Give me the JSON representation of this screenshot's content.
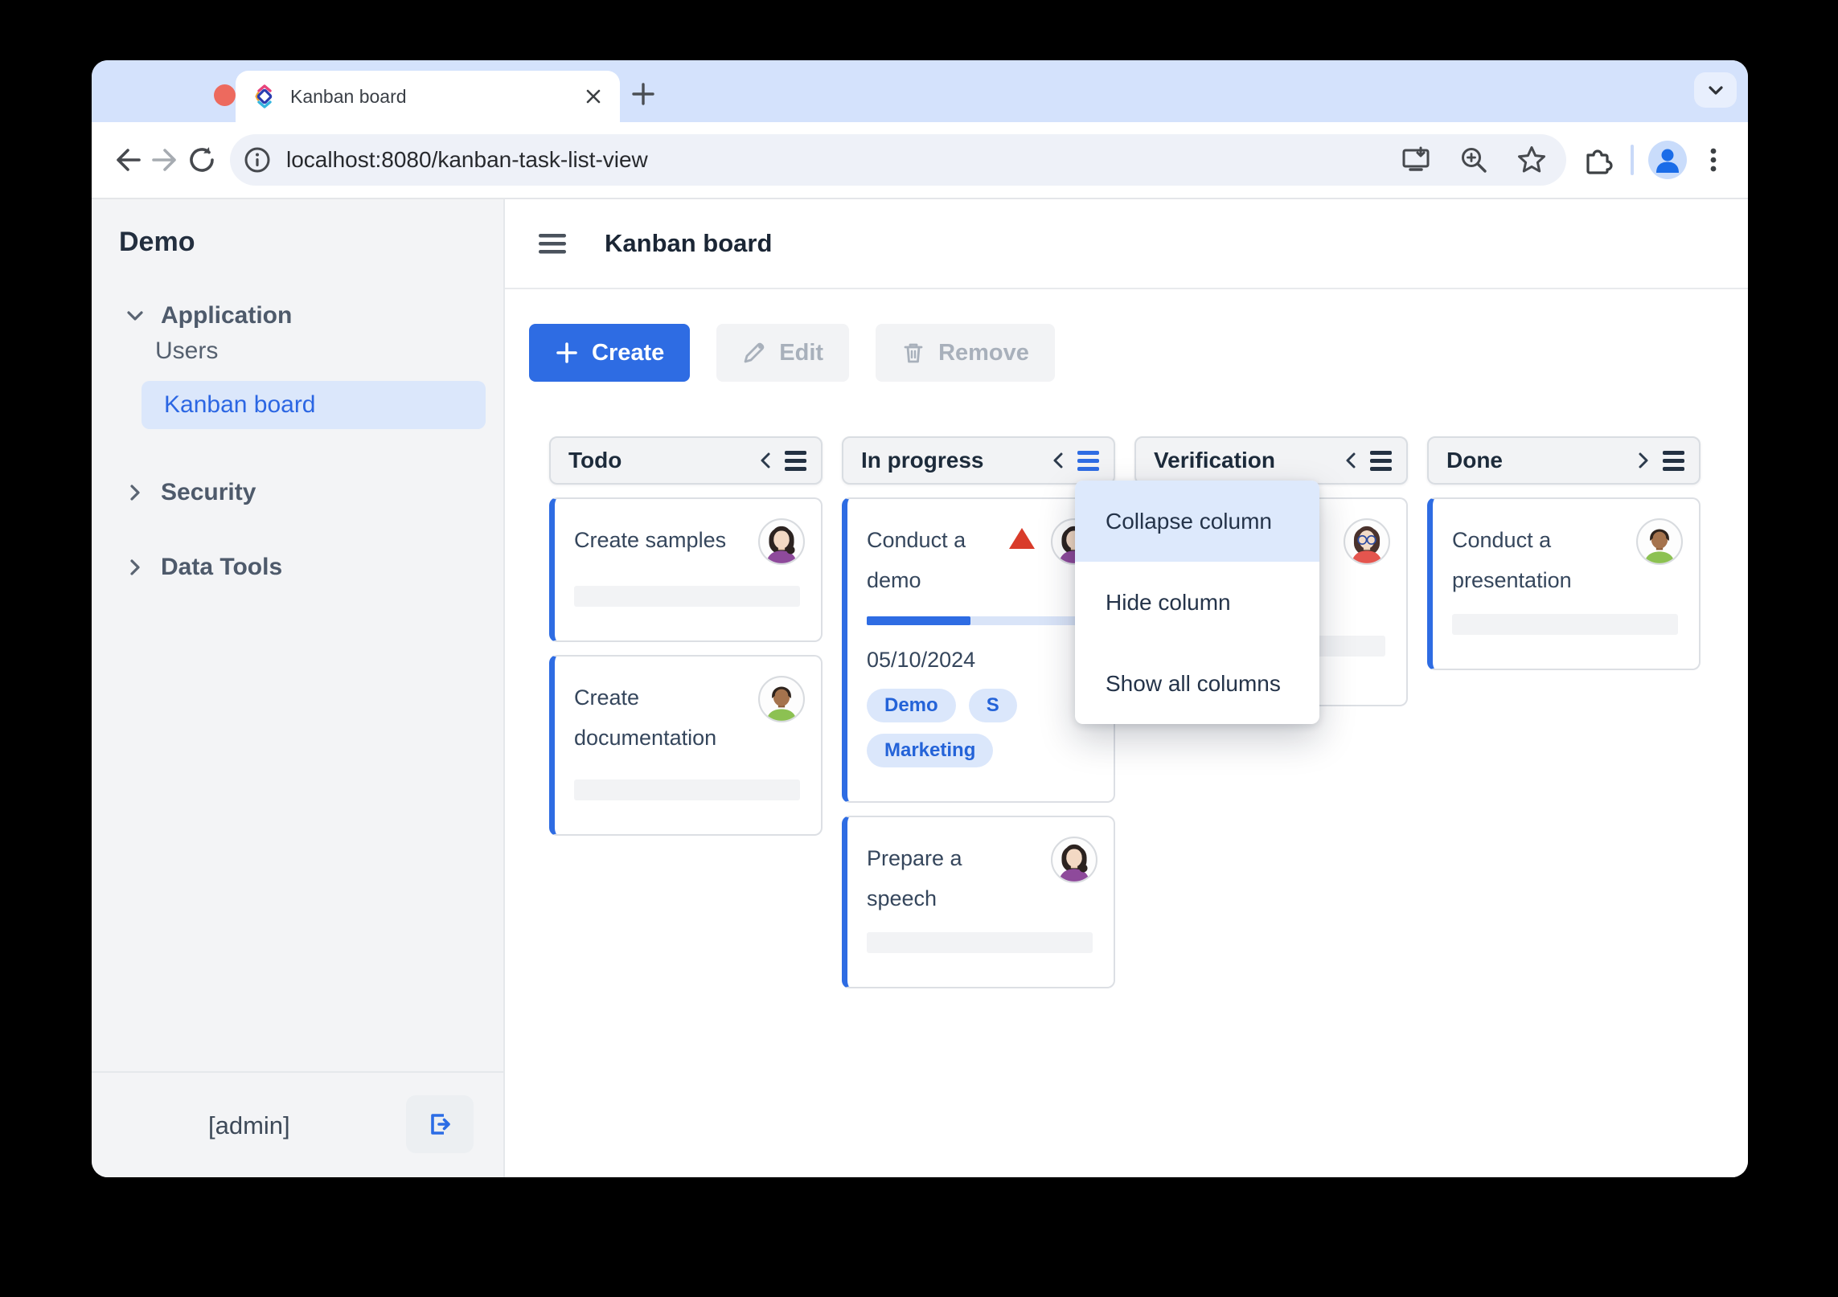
{
  "browser": {
    "tab_title": "Kanban board",
    "url": "localhost:8080/kanban-task-list-view"
  },
  "sidebar": {
    "app_title": "Demo",
    "sections": [
      {
        "label": "Application",
        "expanded": true
      },
      {
        "label": "Security",
        "expanded": false
      },
      {
        "label": "Data Tools",
        "expanded": false
      }
    ],
    "items": [
      {
        "label": "Users",
        "selected": false
      },
      {
        "label": "Kanban board",
        "selected": true
      }
    ],
    "footer": {
      "user": "[admin]"
    }
  },
  "main": {
    "title": "Kanban board",
    "toolbar": {
      "create": "Create",
      "edit": "Edit",
      "remove": "Remove"
    }
  },
  "board": {
    "columns": [
      {
        "title": "Todo",
        "collapse_direction": "left",
        "cards": [
          {
            "title": "Create samples",
            "avatar": "woman-purple"
          },
          {
            "title": "Create documentation",
            "avatar": "man-green"
          }
        ]
      },
      {
        "title": "In progress",
        "collapse_direction": "left",
        "menu_open": true,
        "cards": [
          {
            "title": "Conduct a demo",
            "avatar": "woman-purple",
            "priority": "high",
            "progress_percent": 46,
            "due_date": "05/10/2024",
            "tags": [
              "Demo",
              "S",
              "Marketing"
            ]
          },
          {
            "title": "Prepare a speech",
            "avatar": "woman-purple"
          }
        ]
      },
      {
        "title": "Verification",
        "collapse_direction": "left",
        "cards": [
          {
            "avatar": "woman-glasses-red"
          }
        ]
      },
      {
        "title": "Done",
        "collapse_direction": "right",
        "cards": [
          {
            "title": "Conduct a presentation",
            "avatar": "man-green"
          }
        ]
      }
    ]
  },
  "context_menu": {
    "items": [
      {
        "label": "Collapse column",
        "highlighted": true
      },
      {
        "label": "Hide column",
        "highlighted": false
      },
      {
        "label": "Show all columns",
        "highlighted": false
      }
    ]
  },
  "colors": {
    "accent_blue": "#2e6ce3",
    "selected_bg": "#dbe7fb",
    "tag_bg": "#dbe7fb",
    "tag_text": "#2463d8",
    "priority_red": "#d93b2a",
    "tabstrip": "#d4e2fc"
  }
}
